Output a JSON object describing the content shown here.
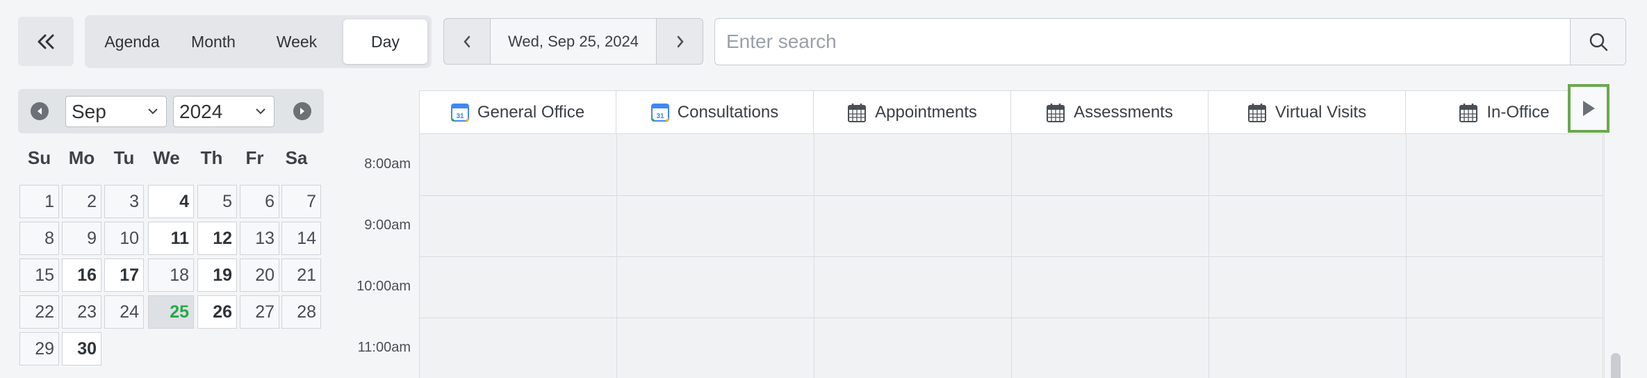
{
  "toolbar": {
    "collapse_icon": "double-chevron-left-icon",
    "views": [
      {
        "label": "Agenda",
        "active": false
      },
      {
        "label": "Month",
        "active": false
      },
      {
        "label": "Week",
        "active": false
      },
      {
        "label": "Day",
        "active": true
      }
    ],
    "date_label": "Wed, Sep 25, 2024",
    "prev_icon": "chevron-left-icon",
    "next_icon": "chevron-right-icon",
    "search_placeholder": "Enter search",
    "search_icon": "search-icon"
  },
  "mini_calendar": {
    "month": "Sep",
    "year": "2024",
    "weekdays": [
      "Su",
      "Mo",
      "Tu",
      "We",
      "Th",
      "Fr",
      "Sa"
    ],
    "weeks": [
      [
        {
          "d": "1"
        },
        {
          "d": "2"
        },
        {
          "d": "3"
        },
        {
          "d": "4",
          "bold": true
        },
        {
          "d": "5"
        },
        {
          "d": "6"
        },
        {
          "d": "7"
        }
      ],
      [
        {
          "d": "8"
        },
        {
          "d": "9"
        },
        {
          "d": "10"
        },
        {
          "d": "11",
          "bold": true
        },
        {
          "d": "12",
          "bold": true
        },
        {
          "d": "13"
        },
        {
          "d": "14"
        }
      ],
      [
        {
          "d": "15"
        },
        {
          "d": "16",
          "bold": true
        },
        {
          "d": "17",
          "bold": true
        },
        {
          "d": "18"
        },
        {
          "d": "19",
          "bold": true
        },
        {
          "d": "20"
        },
        {
          "d": "21"
        }
      ],
      [
        {
          "d": "22"
        },
        {
          "d": "23"
        },
        {
          "d": "24"
        },
        {
          "d": "25",
          "today": true
        },
        {
          "d": "26",
          "bold": true
        },
        {
          "d": "27"
        },
        {
          "d": "28"
        }
      ],
      [
        {
          "d": "29"
        },
        {
          "d": "30",
          "bold": true
        }
      ]
    ],
    "today_color": "#27a84a"
  },
  "resources": [
    {
      "name": "General Office",
      "icon": "google-calendar-icon"
    },
    {
      "name": "Consultations",
      "icon": "google-calendar-icon"
    },
    {
      "name": "Appointments",
      "icon": "calendar-icon"
    },
    {
      "name": "Assessments",
      "icon": "calendar-icon"
    },
    {
      "name": "Virtual Visits",
      "icon": "calendar-icon"
    },
    {
      "name": "In-Office",
      "icon": "calendar-icon"
    }
  ],
  "resource_next_icon": "play-icon",
  "time_slots": [
    "8:00am",
    "9:00am",
    "10:00am",
    "11:00am"
  ],
  "colors": {
    "highlight_border": "#6aa84f"
  }
}
